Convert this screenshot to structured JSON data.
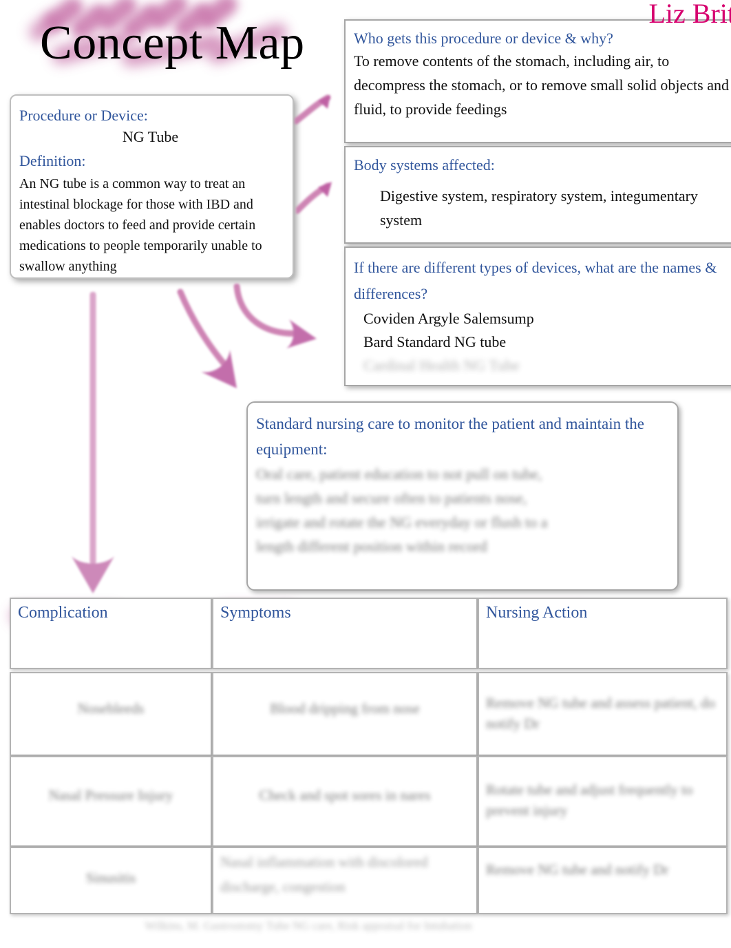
{
  "document": {
    "title": "Concept Map",
    "author": "Liz Brit"
  },
  "procedure_card": {
    "label": "Procedure or Device:",
    "value": "NG Tube",
    "definition_label": "Definition:",
    "definition_text": "An NG tube is a common way to treat an intestinal blockage for those with IBD and enables doctors to feed and provide certain medications to people temporarily unable to swallow anything"
  },
  "who_box": {
    "question": "Who gets this procedure or device & why?",
    "answer": "To remove contents of the stomach, including air, to decompress the stomach, or to remove small solid objects and fluid, to provide feedings"
  },
  "body_systems_box": {
    "question": "Body systems affected:",
    "answer": "Digestive system, respiratory system, integumentary system"
  },
  "types_box": {
    "question": "If there are different types of devices, what are the names & differences?",
    "items": [
      "Coviden Argyle Salemsump",
      "Bard Standard NG tube"
    ],
    "illegible_line": "Cardinal Health NG Tube"
  },
  "care_box": {
    "question": "Standard nursing care to monitor the patient and maintain the equipment:",
    "illegible_lines": [
      "Oral care, patient education to not pull on tube,",
      "turn length and secure often to patients nose,",
      "irrigate and rotate the NG everyday or flush to a",
      "length different position within record"
    ]
  },
  "table": {
    "headers": [
      "Complication",
      "Symptoms",
      "Nursing Action"
    ],
    "rows": [
      {
        "complication": "Nosebleeds",
        "symptoms": "Blood dripping from nose",
        "nursing_action": "Remove NG tube and assess patient, do notify Dr"
      },
      {
        "complication": "Nasal Pressure Injury",
        "symptoms": "Check and spot sores in nares",
        "nursing_action": "Rotate tube and adjust frequently to prevent injury"
      },
      {
        "complication": "Sinusitis",
        "symptoms": "Nasal inflammation with discolored discharge, congestion",
        "nursing_action": "Remove NG tube and notify Dr"
      }
    ]
  },
  "footer": {
    "illegible_text": "Wilkins, M. Gastrostomy Tube NG care, Risk appraisal for Intubation"
  },
  "colors": {
    "heading_blue": "#31569c",
    "highlighter_pink": "#c977ac",
    "author_pink": "#d6006e",
    "body_text": "#101010"
  }
}
